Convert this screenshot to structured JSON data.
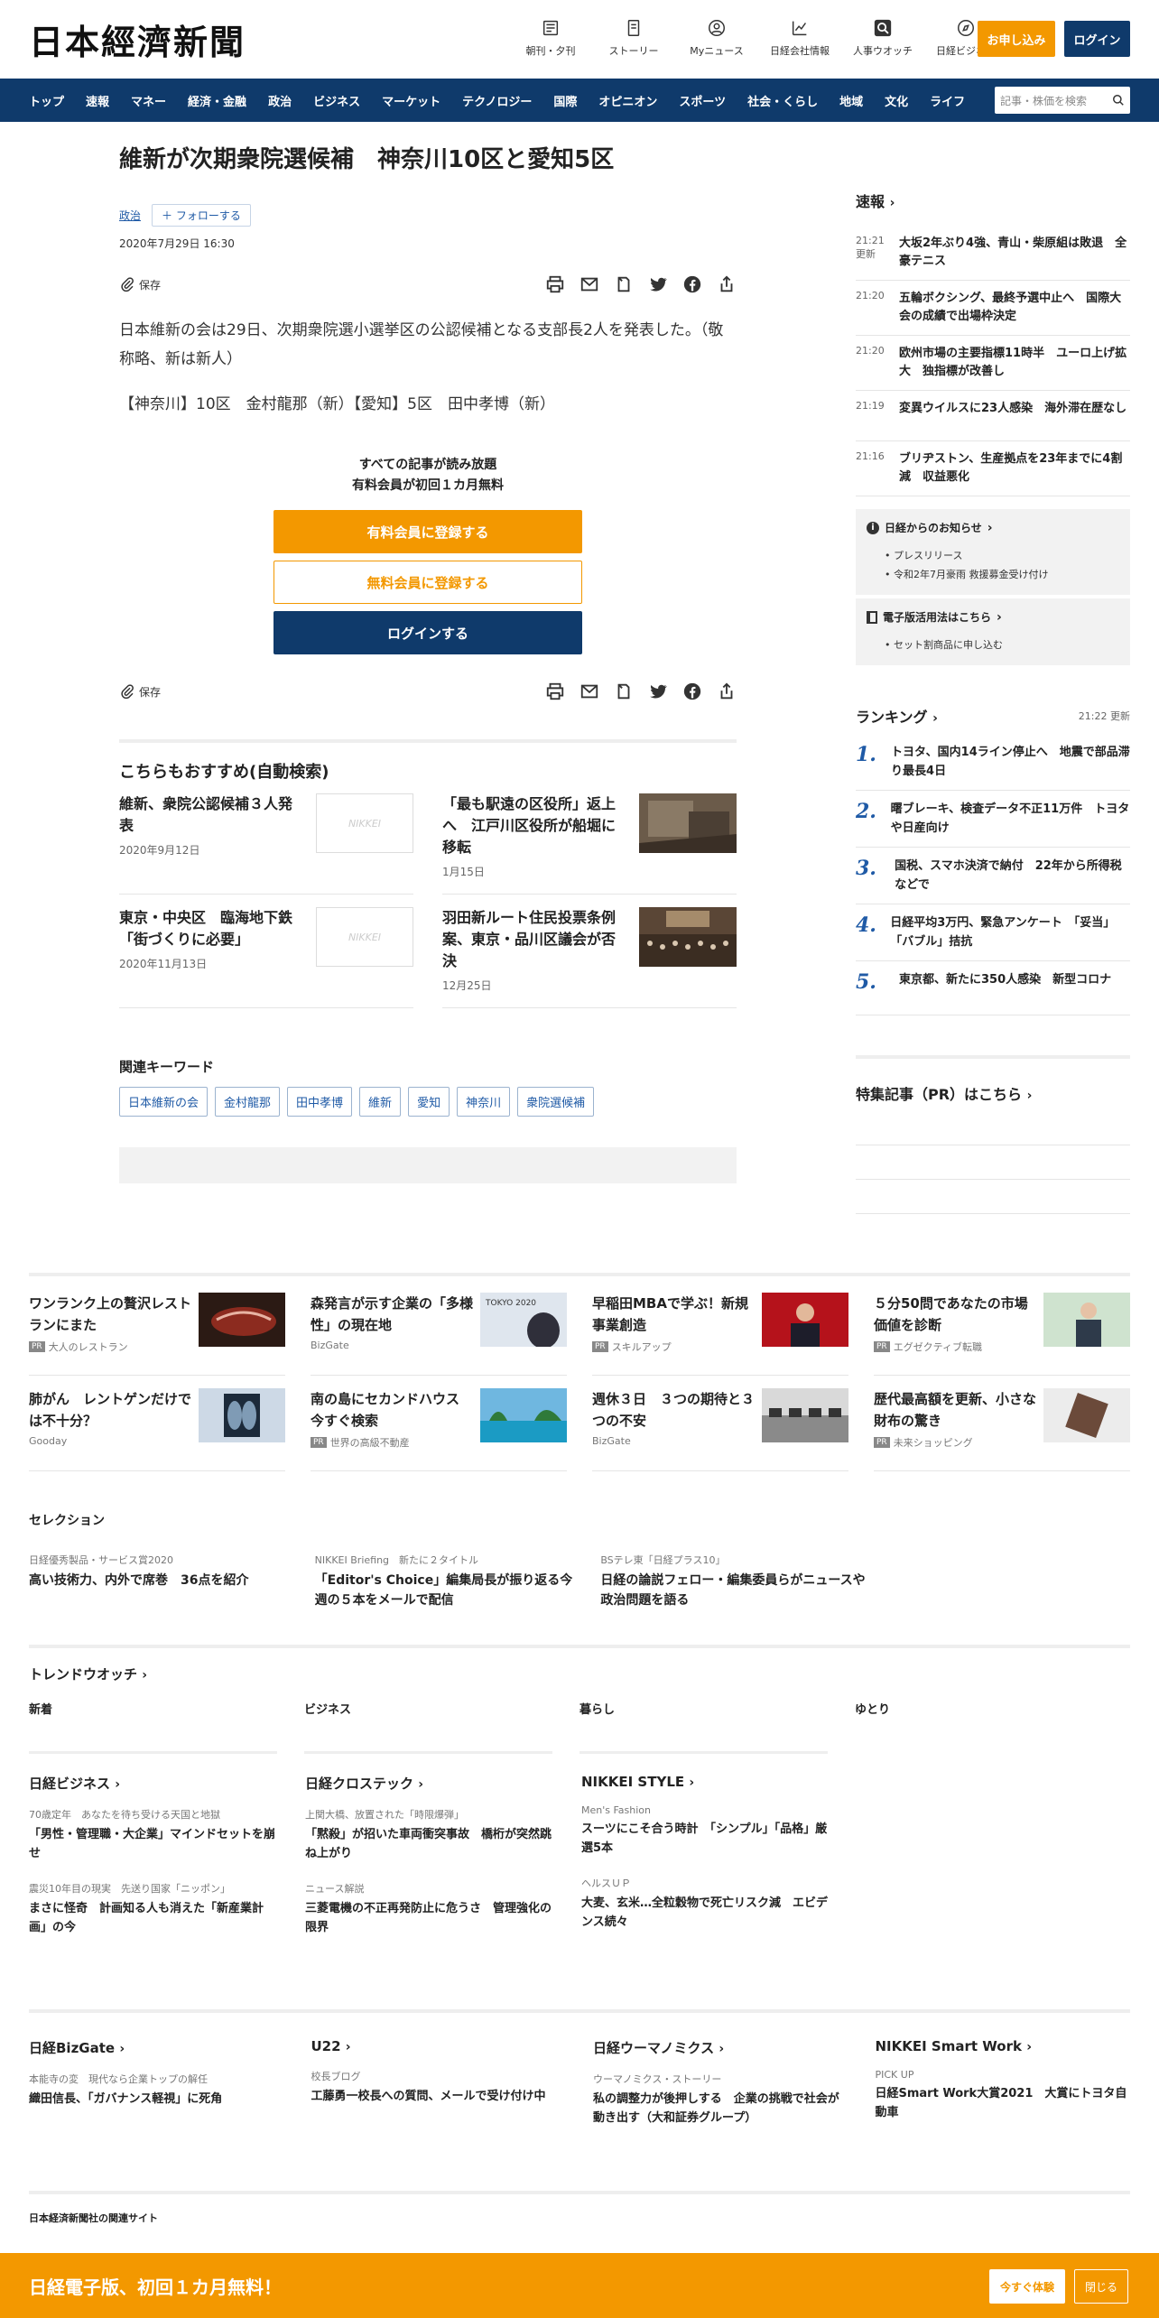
{
  "header": {
    "logo": "日本經濟新聞",
    "icons": [
      {
        "label": "朝刊・夕刊",
        "icon": "newspaper-icon"
      },
      {
        "label": "ストーリー",
        "icon": "story-icon"
      },
      {
        "label": "Myニュース",
        "icon": "person-icon"
      },
      {
        "label": "日経会社情報",
        "icon": "chart-icon"
      },
      {
        "label": "人事ウオッチ",
        "icon": "search-icon"
      },
      {
        "label": "日経ビジネス",
        "icon": "compass-icon"
      }
    ],
    "subscribe": "お申し込み",
    "login": "ログイン"
  },
  "nav": {
    "items": [
      "トップ",
      "速報",
      "マネー",
      "経済・金融",
      "政治",
      "ビジネス",
      "マーケット",
      "テクノロジー",
      "国際",
      "オピニオン",
      "スポーツ",
      "社会・くらし",
      "地域",
      "文化",
      "ライフ"
    ],
    "search_placeholder": "記事・株価を検索"
  },
  "article": {
    "title": "維新が次期衆院選候補　神奈川10区と愛知5区",
    "category": "政治",
    "follow": "フォローする",
    "date": "2020年7月29日 16:30",
    "save": "保存",
    "body1": "日本維新の会は29日、次期衆院選小選挙区の公認候補となる支部長2人を発表した。（敬称略、新は新人）",
    "body2": "【神奈川】10区　金村龍那（新）【愛知】5区　田中孝博（新）"
  },
  "paywall": {
    "line1": "すべての記事が読み放題",
    "line2": "有料会員が初回１カ月無料",
    "paid": "有料会員に登録する",
    "free": "無料会員に登録する",
    "login": "ログインする"
  },
  "recommend": {
    "heading": "こちらもおすすめ(自動検索)",
    "items": [
      {
        "title": "維新、衆院公認候補３人発表",
        "date": "2020年9月12日",
        "thumb": "NIKKEI"
      },
      {
        "title": "「最も駅遠の区役所」返上へ　江戸川区役所が船堀に移転",
        "date": "1月15日",
        "thumb": ""
      },
      {
        "title": "東京・中央区　臨海地下鉄「街づくりに必要」",
        "date": "2020年11月13日",
        "thumb": "NIKKEI"
      },
      {
        "title": "羽田新ルート住民投票条例案、東京・品川区議会が否決",
        "date": "12月25日",
        "thumb": ""
      }
    ]
  },
  "keywords": {
    "heading": "関連キーワード",
    "items": [
      "日本維新の会",
      "金村龍那",
      "田中孝博",
      "維新",
      "愛知",
      "神奈川",
      "衆院選候補"
    ]
  },
  "sidebar": {
    "flash_heading": "速報",
    "flash": [
      {
        "time": "21:21",
        "sub": "更新",
        "text": "大坂2年ぶり4強、青山・柴原組は敗退　全豪テニス"
      },
      {
        "time": "21:20",
        "sub": "",
        "text": "五輪ボクシング、最終予選中止へ　国際大会の成績で出場枠決定"
      },
      {
        "time": "21:20",
        "sub": "",
        "text": "欧州市場の主要指標11時半　ユーロ上げ拡大　独指標が改善し"
      },
      {
        "time": "21:19",
        "sub": "",
        "text": "変異ウイルスに23人感染　海外滞在歴なし"
      },
      {
        "time": "21:16",
        "sub": "",
        "text": "ブリヂストン、生産拠点を23年までに4割減　収益悪化"
      }
    ],
    "notice_heading": "日経からのお知らせ",
    "notices": [
      "プレスリリース",
      "令和2年7月豪雨 救援募金受け付け"
    ],
    "digital_heading": "電子版活用法はこちら",
    "digital": [
      "セット割商品に申し込む"
    ],
    "ranking_heading": "ランキング",
    "ranking_time": "21:22  更新",
    "ranking": [
      {
        "n": "1.",
        "text": "トヨタ、国内14ライン停止へ　地震で部品滞り最長4日"
      },
      {
        "n": "2.",
        "text": "曙ブレーキ、検査データ不正11万件　トヨタや日産向け"
      },
      {
        "n": "3.",
        "text": "国税、スマホ決済で納付　22年から所得税などで"
      },
      {
        "n": "4.",
        "text": "日経平均3万円、緊急アンケート　「妥当」「バブル」拮抗"
      },
      {
        "n": "5.",
        "text": "東京都、新たに350人感染　新型コロナ"
      }
    ],
    "pr_heading": "特集記事（PR）はこちら"
  },
  "promos": [
    {
      "title": "ワンランク上の贅沢レストランにまた",
      "src": "大人のレストラン",
      "pr": true
    },
    {
      "title": "森発言が示す企業の「多様性」の現在地",
      "src": "BizGate",
      "pr": false
    },
    {
      "title": "早稲田MBAで学ぶ！新規事業創造",
      "src": "スキルアップ",
      "pr": true
    },
    {
      "title": "５分50問であなたの市場価値を診断",
      "src": "エグゼクティブ転職",
      "pr": true
    },
    {
      "title": "肺がん　レントゲンだけでは不十分？",
      "src": "Gooday",
      "pr": false
    },
    {
      "title": "南の島にセカンドハウス　今すぐ検索",
      "src": "世界の高級不動産",
      "pr": true
    },
    {
      "title": "週休３日　３つの期待と３つの不安",
      "src": "BizGate",
      "pr": false
    },
    {
      "title": "歴代最高額を更新、小さな財布の驚き",
      "src": "未来ショッピング",
      "pr": true
    }
  ],
  "pr_label": "PR",
  "selection": {
    "heading": "セレクション",
    "items": [
      {
        "cat": "日経優秀製品・サービス賞2020",
        "title": "高い技術力、内外で席巻　36点を紹介"
      },
      {
        "cat": "NIKKEI Briefing　新たに２タイトル",
        "title": "「Editor's Choice」編集局長が振り返る今週の５本をメールで配信"
      },
      {
        "cat": "BSテレ東「日経プラス10」",
        "title": "日経の論説フェロー・編集委員らがニュースや政治問題を語る"
      }
    ]
  },
  "trend": {
    "heading": "トレンドウオッチ",
    "cols": [
      "新着",
      "ビジネス",
      "暮らし",
      "ゆとり"
    ]
  },
  "mags": [
    {
      "name": "日経ビジネス",
      "items": [
        {
          "cat": "70歳定年　あなたを待ち受ける天国と地獄",
          "title": "「男性・管理職・大企業」マインドセットを崩せ"
        },
        {
          "cat": "震災10年目の現実　先送り国家「ニッポン」",
          "title": "まさに怪奇　計画知る人も消えた「新産業計画」の今"
        }
      ]
    },
    {
      "name": "日経クロステック",
      "items": [
        {
          "cat": "上関大橋、放置された「時限爆弾」",
          "title": "「黙殺」が招いた車両衝突事故　橋桁が突然跳ね上がり"
        },
        {
          "cat": "ニュース解説",
          "title": "三菱電機の不正再発防止に危うさ　管理強化の限界"
        }
      ]
    },
    {
      "name": "NIKKEI STYLE",
      "items": [
        {
          "cat": "Men's Fashion",
          "title": "スーツにこそ合う時計　「シンプル」「品格」厳選5本"
        },
        {
          "cat": "ヘルスＵＰ",
          "title": "大麦、玄米…全粒穀物で死亡リスク減　エビデンス続々"
        }
      ]
    }
  ],
  "mags2": [
    {
      "name": "日経BizGate",
      "cat": "本能寺の変　現代なら企業トップの解任",
      "title": "織田信長、「ガバナンス軽視」に死角"
    },
    {
      "name": "U22",
      "cat": "校長ブログ",
      "title": "工藤勇一校長への質問、メールで受け付け中"
    },
    {
      "name": "日経ウーマノミクス",
      "cat": "ウーマノミクス・ストーリー",
      "title": "私の調整力が後押しする　企業の挑戦で社会が動き出す（大和証券グループ）"
    },
    {
      "name": "NIKKEI Smart Work",
      "cat": "PICK UP",
      "title": "日経Smart Work大賞2021　大賞にトヨタ自動車"
    }
  ],
  "related_sites": "日本経済新聞社の関連サイト",
  "bottom": {
    "text": "日経電子版、初回１カ月無料！",
    "try": "今すぐ体験",
    "close": "閉じる"
  },
  "colors": {
    "navy": "#0f3a6b",
    "orange": "#f39800",
    "link": "#1f5aa6"
  }
}
